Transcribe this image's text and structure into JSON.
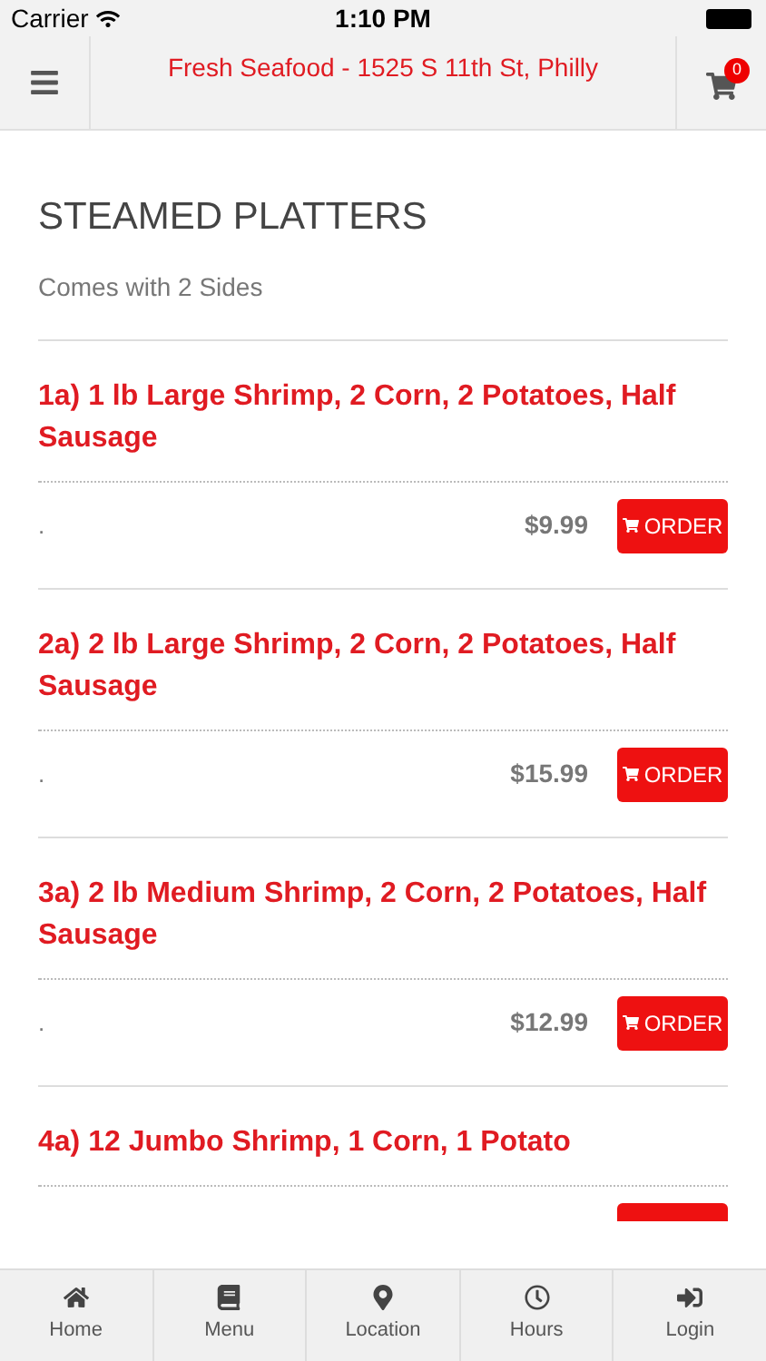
{
  "status_bar": {
    "carrier": "Carrier",
    "time": "1:10 PM"
  },
  "header": {
    "title": "Fresh Seafood - 1525 S 11th St, Philly",
    "cart_count": "0"
  },
  "section": {
    "title": "STEAMED PLATTERS",
    "subtitle": "Comes with 2 Sides"
  },
  "items": [
    {
      "name": "1a) 1 lb Large Shrimp, 2 Corn, 2 Potatoes, Half Sausage",
      "note": ".",
      "price": "$9.99",
      "order_label": "ORDER"
    },
    {
      "name": "2a) 2 lb Large Shrimp, 2 Corn, 2 Potatoes, Half Sausage",
      "note": ".",
      "price": "$15.99",
      "order_label": "ORDER"
    },
    {
      "name": "3a) 2 lb Medium Shrimp, 2 Corn, 2 Potatoes, Half Sausage",
      "note": ".",
      "price": "$12.99",
      "order_label": "ORDER"
    },
    {
      "name": "4a) 12 Jumbo Shrimp, 1 Corn, 1 Potato"
    }
  ],
  "tabs": [
    {
      "kind": "home",
      "label": "Home"
    },
    {
      "kind": "menu",
      "label": "Menu"
    },
    {
      "kind": "location",
      "label": "Location"
    },
    {
      "kind": "hours",
      "label": "Hours"
    },
    {
      "kind": "login",
      "label": "Login"
    }
  ]
}
